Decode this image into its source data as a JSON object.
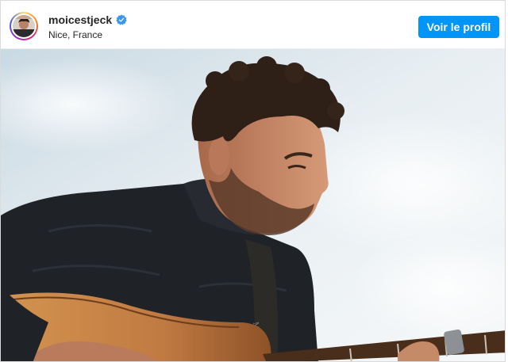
{
  "post": {
    "header": {
      "username": "moicestjeck",
      "verified": true,
      "location": "Nice, France",
      "profile_button_label": "Voir le profil"
    },
    "image": {
      "description_icon": "photo",
      "colors": {
        "sky_light": "#eef2f3",
        "sky_blue": "#c3d5e0",
        "shirt": "#1f2227",
        "hair": "#2e1f17",
        "skin": "#c88b6b",
        "guitar": "#c07a42"
      }
    },
    "colors": {
      "accent": "#0095f6",
      "verified_badge": "#3897f0",
      "text": "#262626"
    }
  }
}
